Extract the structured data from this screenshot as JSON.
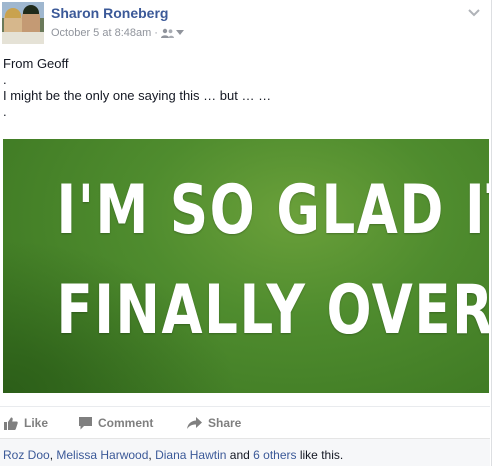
{
  "post": {
    "author": "Sharon Roneberg",
    "timestamp": "October 5 at 8:48am",
    "separator": "·",
    "audience_icon": "friends-icon",
    "text_lines": [
      "From Geoff",
      ".",
      "I might be the only one saying this … but … …",
      "."
    ],
    "image": {
      "line1": "I'M SO GLAD IT'S",
      "line2": "FINALLY OVER.",
      "background": "#4f8c2e"
    }
  },
  "actions": {
    "like": "Like",
    "comment": "Comment",
    "share": "Share"
  },
  "likes": {
    "people": [
      "Roz Doo",
      "Melissa Harwood",
      "Diana Hawtin"
    ],
    "sep1": ", ",
    "sep2": ", ",
    "and_text": " and ",
    "others": "6 others",
    "suffix": " like this."
  },
  "colors": {
    "link": "#3b5998",
    "muted": "#90949c",
    "action": "#7f7f7f",
    "footer_bg": "#f6f7f9"
  }
}
